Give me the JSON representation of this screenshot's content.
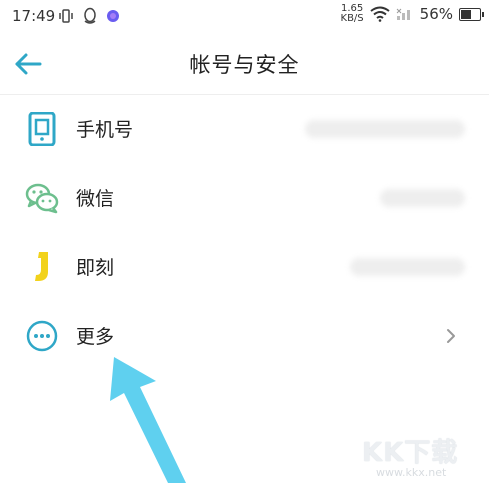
{
  "status_bar": {
    "time": "17:49",
    "net_speed_value": "1.65",
    "net_speed_unit": "KB/S",
    "battery_percent": "56%",
    "battery_level": 0.56
  },
  "header": {
    "title": "帐号与安全"
  },
  "list": [
    {
      "label": "手机号",
      "icon": "phone-icon",
      "color": "#2fa7c7"
    },
    {
      "label": "微信",
      "icon": "wechat-icon",
      "color": "#6dbf8e"
    },
    {
      "label": "即刻",
      "icon": "jike-icon",
      "color": "#f2d21b"
    },
    {
      "label": "更多",
      "icon": "more-icon",
      "color": "#2fa7c7"
    }
  ],
  "colors": {
    "accent": "#2fa7c7",
    "arrow": "#5fd0ef"
  },
  "watermark": {
    "brand": "KK下载",
    "url": "www.kkx.net"
  }
}
